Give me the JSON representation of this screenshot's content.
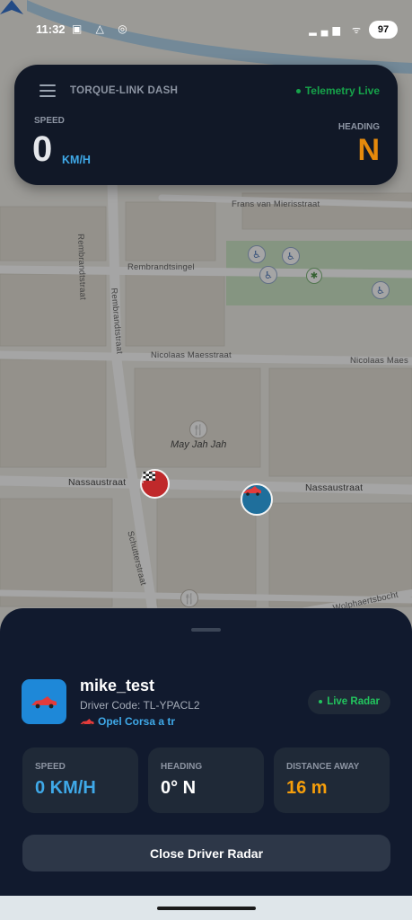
{
  "statusbar": {
    "time": "11:32",
    "battery": "97"
  },
  "dash": {
    "title": "TORQUE-LINK DASH",
    "telemetry_status": "Telemetry Live",
    "speed_label": "SPEED",
    "speed_value": "0",
    "speed_unit": "KM/H",
    "heading_label": "HEADING",
    "heading_value": "N",
    "colors": {
      "accent": "#3fa9e8",
      "heading": "#e58a0c",
      "live": "#16a34a"
    }
  },
  "map": {
    "streets": [
      "Frans van Mierisstraat",
      "Rembrandtsingel",
      "Nicolaas Maesstraat",
      "Nicolaas Maes",
      "Nassaustraat",
      "Nassaustraat",
      "Rembrandtstraat",
      "Rembrandtstraat",
      "Schutterstraat",
      "Wolphaertsbocht"
    ],
    "poi_name": "May Jah Jah"
  },
  "driver": {
    "name": "mike_test",
    "code": "Driver Code: TL-YPACL2",
    "car": "Opel Corsa a tr",
    "radar_status": "Live Radar"
  },
  "stats": [
    {
      "label": "SPEED",
      "value": "0 KM/H",
      "color": "#3fa9e8"
    },
    {
      "label": "HEADING",
      "value": "0° N",
      "color": "#ffffff"
    },
    {
      "label": "DISTANCE AWAY",
      "value": "16 m",
      "color": "#f59e0b"
    }
  ],
  "close_button": {
    "label": "Close Driver Radar"
  }
}
